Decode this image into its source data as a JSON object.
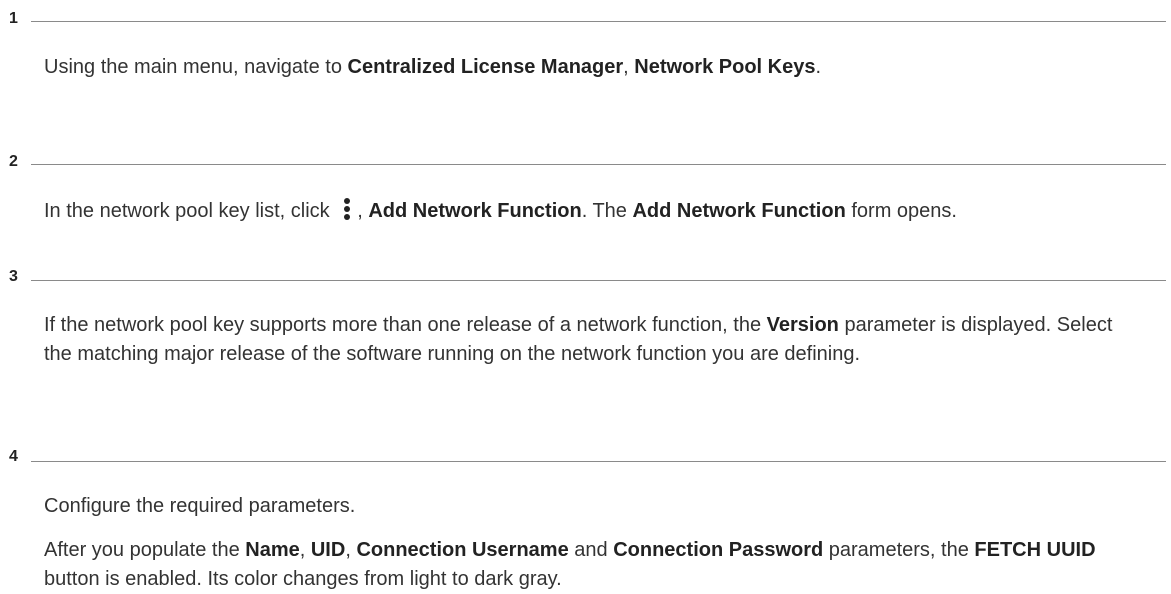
{
  "steps": [
    {
      "number": "1",
      "p1": {
        "t1": "Using the main menu, navigate to ",
        "b1": "Centralized License Manager",
        "t2": ", ",
        "b2": "Network Pool Keys",
        "t3": "."
      }
    },
    {
      "number": "2",
      "p1": {
        "t1": "In the network pool key list, click ",
        "icon": "more-vertical-icon",
        "t2": ", ",
        "b1": "Add Network Function",
        "t3": ". The ",
        "b2": "Add Network Function",
        "t4": " form opens."
      }
    },
    {
      "number": "3",
      "p1": {
        "t1": "If the network pool key supports more than one release of a network function, the ",
        "b1": "Version",
        "t2": " parameter is displayed. Select the matching major release of the software running on the network function you are defining."
      }
    },
    {
      "number": "4",
      "p1": {
        "t1": "Configure the required parameters."
      },
      "p2": {
        "t1": "After you populate the ",
        "b1": "Name",
        "t2": ", ",
        "b2": "UID",
        "t3": ", ",
        "b3": "Connection Username",
        "t4": " and ",
        "b4": "Connection Password",
        "t5": " parameters, the ",
        "b5": "FETCH UUID",
        "t6": " button is enabled. Its color changes from light to dark gray."
      }
    }
  ]
}
